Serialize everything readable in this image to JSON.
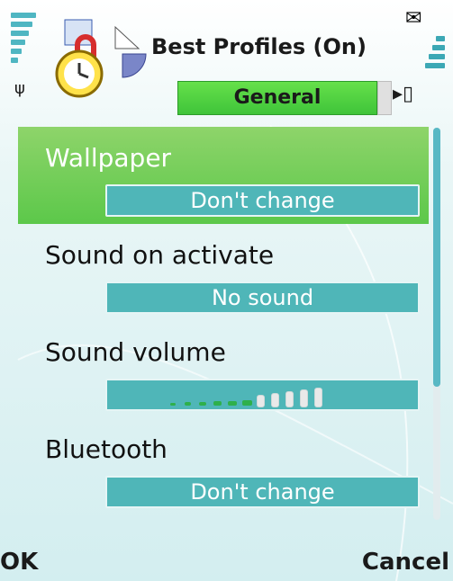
{
  "header": {
    "title": "Best Profiles (On)",
    "active_profile": "General"
  },
  "settings": [
    {
      "label": "Wallpaper",
      "value": "Don't change",
      "selected": true
    },
    {
      "label": "Sound on activate",
      "value": "No sound",
      "selected": false
    },
    {
      "label": "Sound volume",
      "value": "",
      "volume_level": 0.55,
      "selected": false
    },
    {
      "label": "Bluetooth",
      "value": "Don't change",
      "selected": false
    }
  ],
  "softkeys": {
    "left": "OK",
    "right": "Cancel"
  },
  "icons": {
    "signal": "signal-bars-icon",
    "antenna": "antenna-icon",
    "app": "best-profiles-clock-icon",
    "message": "envelope-icon",
    "battery": "battery-bars-icon",
    "tab_arrow": "tab-right-arrow-icon"
  },
  "colors": {
    "selection": "#6fce58",
    "value_box": "#4fb6b8",
    "active_tab": "#4fd23f",
    "signal": "#4fb6c2"
  }
}
